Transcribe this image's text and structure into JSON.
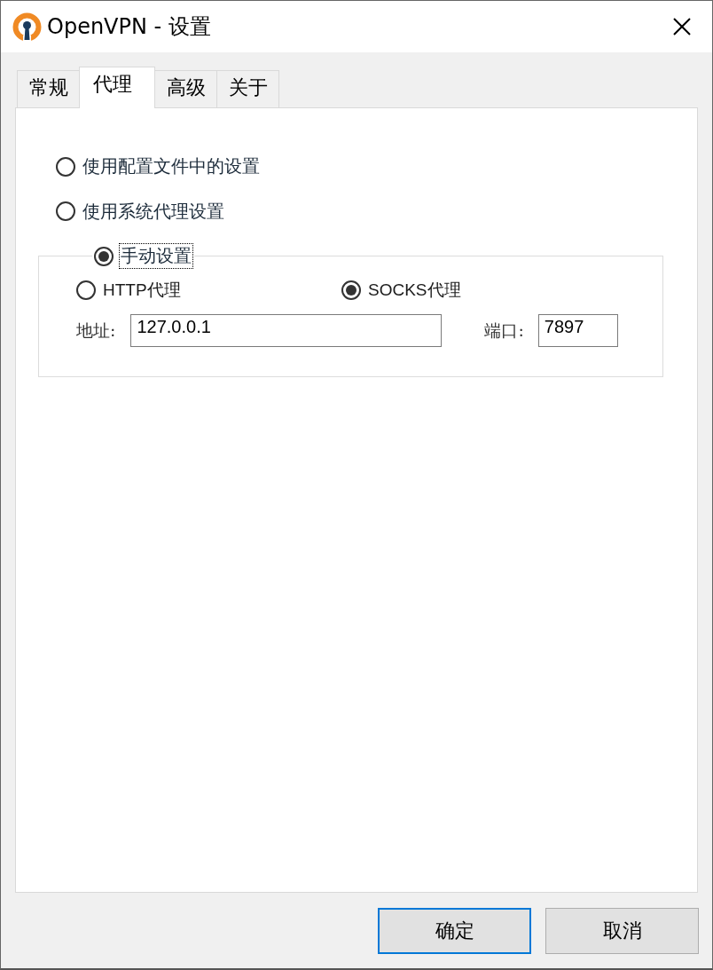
{
  "window": {
    "title": "OpenVPN - 设置"
  },
  "tabs": [
    {
      "label": "常规",
      "selected": false
    },
    {
      "label": "代理",
      "selected": true
    },
    {
      "label": "高级",
      "selected": false
    },
    {
      "label": "关于",
      "selected": false
    }
  ],
  "proxy_options": [
    {
      "label": "使用配置文件中的设置",
      "selected": false,
      "focused": false
    },
    {
      "label": "使用系统代理设置",
      "selected": false,
      "focused": false
    },
    {
      "label": "手动设置",
      "selected": true,
      "focused": true
    }
  ],
  "manual": {
    "protocols": [
      {
        "label": "HTTP代理",
        "selected": false
      },
      {
        "label": "SOCKS代理",
        "selected": true
      }
    ],
    "address": {
      "label": "地址:",
      "value": "127.0.0.1"
    },
    "port": {
      "label": "端口:",
      "value": "7897"
    }
  },
  "buttons": [
    {
      "label": "确定",
      "default": true
    },
    {
      "label": "取消",
      "default": false
    }
  ]
}
